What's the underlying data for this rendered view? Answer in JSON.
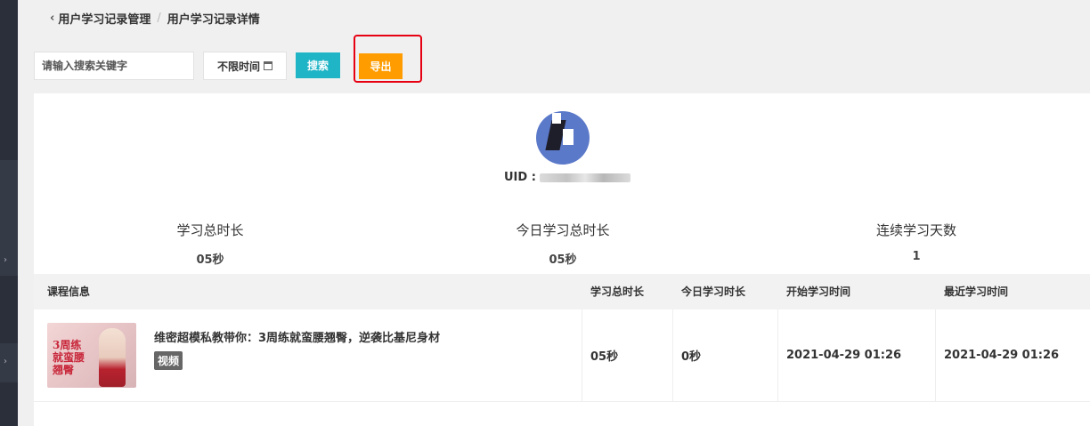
{
  "breadcrumb": {
    "back": "‹",
    "parent": "用户学习记录管理",
    "separator": "/",
    "current": "用户学习记录详情"
  },
  "toolbar": {
    "search_placeholder": "请输入搜索关键字",
    "date_filter_label": "不限时间",
    "search_button": "搜索",
    "export_button": "导出"
  },
  "profile": {
    "uid_label": "UID :"
  },
  "stats": [
    {
      "label": "学习总时长",
      "value": "05秒"
    },
    {
      "label": "今日学习总时长",
      "value": "05秒"
    },
    {
      "label": "连续学习天数",
      "value": "1"
    }
  ],
  "table": {
    "headers": [
      "课程信息",
      "学习总时长",
      "今日学习时长",
      "开始学习时间",
      "最近学习时间"
    ],
    "rows": [
      {
        "title": "维密超模私教带你：3周练就蛮腰翘臀，逆袭比基尼身材",
        "tag": "视频",
        "thumb_text": "3周练就蛮腰翘臀",
        "total": "05秒",
        "today": "0秒",
        "start": "2021-04-29 01:26",
        "latest": "2021-04-29 01:26"
      }
    ]
  },
  "colors": {
    "search_button": "#1fb5c6",
    "export_button": "#ff9c00",
    "highlight_border": "#e60012"
  }
}
